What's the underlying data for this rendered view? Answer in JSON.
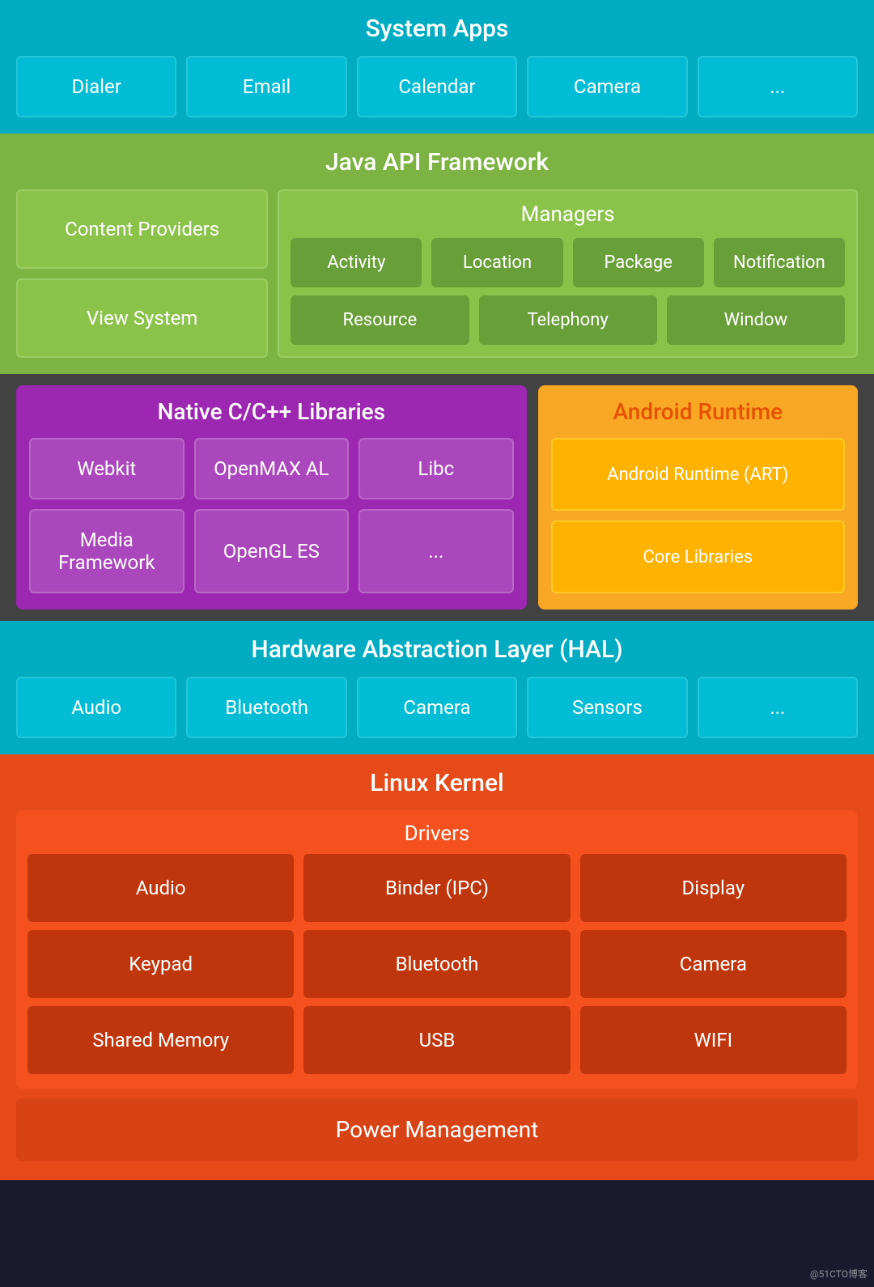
{
  "system_apps": {
    "title": "System Apps",
    "cells": [
      "Dialer",
      "Email",
      "Calendar",
      "Camera",
      "..."
    ]
  },
  "java_api": {
    "title": "Java API Framework",
    "left": {
      "content_providers": "Content Providers",
      "view_system": "View System"
    },
    "managers": {
      "title": "Managers",
      "row1": [
        "Activity",
        "Location",
        "Package",
        "Notification"
      ],
      "row2": [
        "Resource",
        "Telephony",
        "Window"
      ]
    }
  },
  "native": {
    "title": "Native C/C++ Libraries",
    "row1": [
      "Webkit",
      "OpenMAX AL",
      "Libc"
    ],
    "row2": [
      "Media Framework",
      "OpenGL ES",
      "..."
    ]
  },
  "android_runtime": {
    "title": "Android Runtime",
    "cell1": "Android Runtime (ART)",
    "cell2": "Core Libraries"
  },
  "hal": {
    "title": "Hardware Abstraction Layer (HAL)",
    "cells": [
      "Audio",
      "Bluetooth",
      "Camera",
      "Sensors",
      "..."
    ]
  },
  "linux": {
    "title": "Linux Kernel",
    "drivers": {
      "title": "Drivers",
      "row1": [
        "Audio",
        "Binder (IPC)",
        "Display"
      ],
      "row2": [
        "Keypad",
        "Bluetooth",
        "Camera"
      ],
      "row3": [
        "Shared Memory",
        "USB",
        "WIFI"
      ]
    },
    "power_management": "Power Management"
  }
}
